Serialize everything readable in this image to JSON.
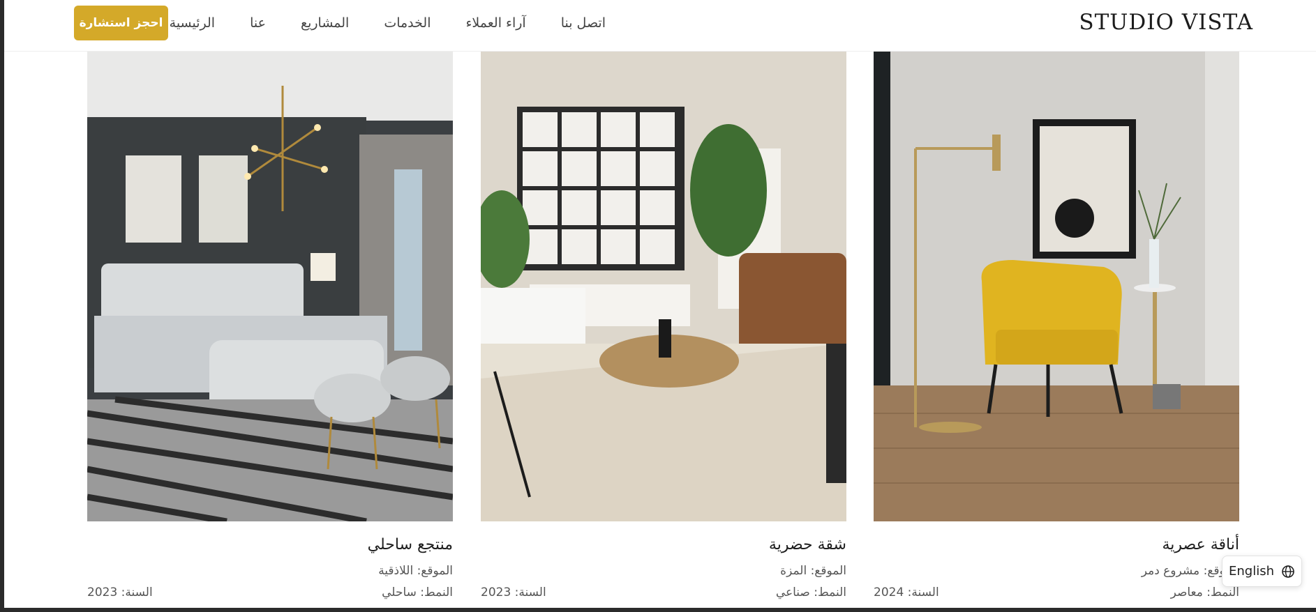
{
  "brand": {
    "logo": "STUDIO VISTA",
    "accent": "#d4a929"
  },
  "nav": {
    "items": [
      {
        "label": "الرئيسية"
      },
      {
        "label": "عنا"
      },
      {
        "label": "المشاريع"
      },
      {
        "label": "الخدمات"
      },
      {
        "label": "آراء العملاء"
      },
      {
        "label": "اتصل بنا"
      }
    ],
    "cta_label": "احجز استشارة"
  },
  "projects": [
    {
      "title": "أناقة عصرية",
      "location": "الموقع: مشروع دمر",
      "style": "النمط: معاصر",
      "year": "السنة: 2024",
      "image": "modern-living-room-yellow-armchair"
    },
    {
      "title": "شقة حضرية",
      "location": "الموقع: المزة",
      "style": "النمط: صناعي",
      "year": "السنة: 2023",
      "image": "urban-living-room-gallery-wall"
    },
    {
      "title": "منتجع ساحلي",
      "location": "الموقع: اللاذقية",
      "style": "النمط: ساحلي",
      "year": "السنة: 2023",
      "image": "coastal-bedroom-chandelier"
    }
  ],
  "language_toggle": {
    "label": "English",
    "icon": "globe-icon"
  }
}
